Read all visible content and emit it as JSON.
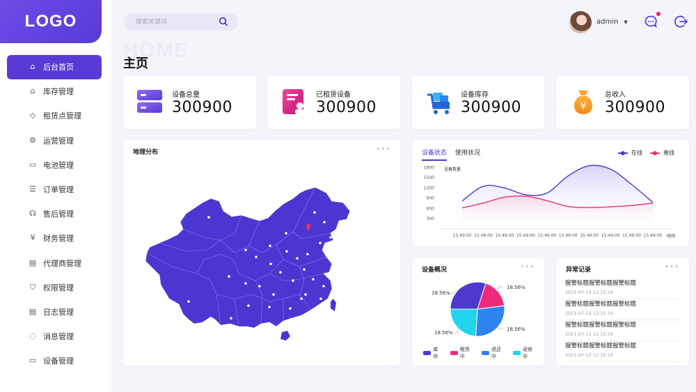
{
  "logo": "LOGO",
  "sidebar": {
    "items": [
      {
        "label": "后台首页",
        "icon": "home-icon",
        "glyph": "⌂"
      },
      {
        "label": "库存管理",
        "icon": "warehouse-icon",
        "glyph": "⌂"
      },
      {
        "label": "租赁点管理",
        "icon": "cube-icon",
        "glyph": "◇"
      },
      {
        "label": "运营管理",
        "icon": "operation-icon",
        "glyph": "⚙"
      },
      {
        "label": "电池管理",
        "icon": "battery-icon",
        "glyph": "▭"
      },
      {
        "label": "订单管理",
        "icon": "order-icon",
        "glyph": "☰"
      },
      {
        "label": "售后管理",
        "icon": "headset-icon",
        "glyph": "☊"
      },
      {
        "label": "财务管理",
        "icon": "finance-icon",
        "glyph": "¥"
      },
      {
        "label": "代理商管理",
        "icon": "store-icon",
        "glyph": "▤"
      },
      {
        "label": "权限管理",
        "icon": "shield-icon",
        "glyph": "⛉"
      },
      {
        "label": "日志管理",
        "icon": "log-icon",
        "glyph": "▤"
      },
      {
        "label": "消息管理",
        "icon": "message-icon",
        "glyph": "◌"
      },
      {
        "label": "设备管理",
        "icon": "device-icon",
        "glyph": "▭"
      }
    ]
  },
  "header": {
    "search_placeholder": "搜索关键词",
    "username": "admin",
    "caret": "▼"
  },
  "page": {
    "bg_title": "HOME",
    "title": "主页"
  },
  "stats": [
    {
      "label": "设备总量",
      "value": "300900",
      "icon": "server-icon"
    },
    {
      "label": "已租赁设备",
      "value": "300900",
      "icon": "rent-document-icon"
    },
    {
      "label": "设备库存",
      "value": "300900",
      "icon": "cart-icon"
    },
    {
      "label": "总收入",
      "value": "300900",
      "icon": "money-bag-icon"
    }
  ],
  "map_card": {
    "title": "地理分布",
    "more": "•••"
  },
  "line_card": {
    "tabs": [
      "设备状态",
      "使用状况"
    ],
    "legend": [
      "在线",
      "离线"
    ],
    "ylabel": "设备数量",
    "xlabel": "时间"
  },
  "pie_card": {
    "title": "设备概况",
    "more": "•••",
    "slice_labels": [
      "18.56%",
      "18.56%",
      "18.56%",
      "18.56%"
    ],
    "legend": [
      "库存",
      "租赁中",
      "退还中",
      "返修中"
    ]
  },
  "alert_card": {
    "title": "异常记录",
    "more": "•••",
    "items": [
      {
        "title": "报警标题报警标题报警标题",
        "date": "2021-07-13  12:15:16"
      },
      {
        "title": "报警标题报警标题报警标题",
        "date": "2021-07-13  12:15:16"
      },
      {
        "title": "报警标题报警标题报警标题",
        "date": "2021-07-13  12:15:16"
      },
      {
        "title": "报警标题报警标题报警标题",
        "date": "2021-07-13  12:15:16"
      }
    ]
  },
  "colors": {
    "primary": "#5a3ad6",
    "online": "#4c3ad0",
    "offline": "#e8326f",
    "pie": [
      "#4c3ad0",
      "#ee2a7b",
      "#2f84f0",
      "#22d3ee"
    ]
  },
  "chart_data": [
    {
      "type": "line",
      "x": [
        "15:49:00",
        "15:49:00",
        "15:49:00",
        "15:49:00",
        "15:49:00",
        "15:49:00",
        "15:49:00",
        "15:49:00",
        "15:49:00",
        "15:49:00"
      ],
      "yticks": [
        300,
        600,
        900,
        1200,
        1500,
        1800
      ],
      "ylim": [
        0,
        1950
      ],
      "series": [
        {
          "name": "在线",
          "values": [
            820,
            1250,
            1200,
            1000,
            1050,
            1550,
            1850,
            1750,
            1300,
            780
          ]
        },
        {
          "name": "离线",
          "values": [
            620,
            760,
            930,
            960,
            830,
            660,
            630,
            650,
            690,
            760
          ]
        }
      ],
      "xlabel": "时间",
      "ylabel": "设备数量",
      "legend": "top-right"
    },
    {
      "type": "pie",
      "categories": [
        "库存",
        "租赁中",
        "退还中",
        "返修中"
      ],
      "values": [
        30,
        18,
        28,
        24
      ],
      "labels": [
        "18.56%",
        "18.56%",
        "18.56%",
        "18.56%"
      ]
    }
  ]
}
